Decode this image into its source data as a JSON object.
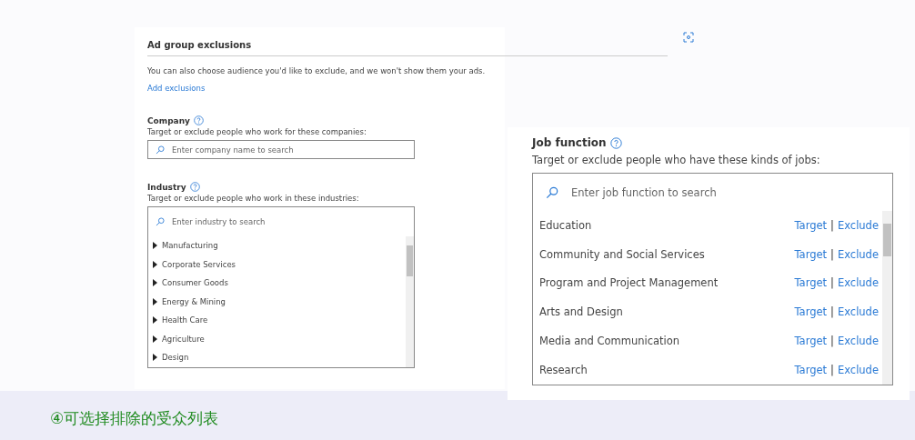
{
  "section": {
    "title": "Ad group exclusions",
    "description": "You can also choose audience you'd like to exclude, and we won't show them your ads.",
    "link": "Add exclusions"
  },
  "company": {
    "label": "Company",
    "hint": "Target or exclude people who work for these companies:",
    "placeholder": "Enter company name to search"
  },
  "industry": {
    "label": "Industry",
    "hint": "Target or exclude people who work in these industries:",
    "placeholder": "Enter industry to search",
    "items": [
      {
        "label": "Manufacturing",
        "expanded": false
      },
      {
        "label": "Corporate Services",
        "expanded": false
      },
      {
        "label": "Consumer Goods",
        "expanded": false
      },
      {
        "label": "Energy & Mining",
        "expanded": false
      },
      {
        "label": "Health Care",
        "expanded": false
      },
      {
        "label": "Agriculture",
        "expanded": false
      },
      {
        "label": "Design",
        "expanded": false
      }
    ]
  },
  "job_function": {
    "label": "Job function",
    "hint": "Target or exclude people who have these kinds of jobs:",
    "placeholder": "Enter job function to search",
    "rows": [
      {
        "label": "Education",
        "target": "Target",
        "separator": "|",
        "exclude": "Exclude"
      },
      {
        "label": "Community and Social Services",
        "target": "Target",
        "separator": "|",
        "exclude": "Exclude"
      },
      {
        "label": "Program and Project Management",
        "target": "Target",
        "separator": "|",
        "exclude": "Exclude"
      },
      {
        "label": "Arts and Design",
        "target": "Target",
        "separator": "|",
        "exclude": "Exclude"
      },
      {
        "label": "Media and Communication",
        "target": "Target",
        "separator": "|",
        "exclude": "Exclude"
      },
      {
        "label": "Research",
        "target": "Target",
        "separator": "|",
        "exclude": "Exclude"
      }
    ]
  },
  "caption": "④可选择排除的受众列表"
}
